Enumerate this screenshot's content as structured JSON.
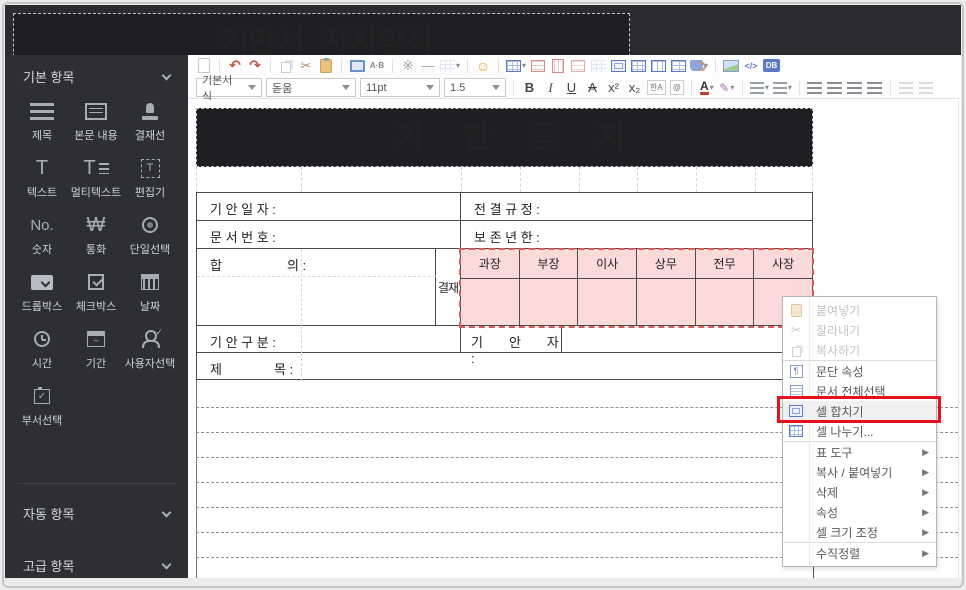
{
  "titlebar": {
    "title": "기안서_자사양식"
  },
  "sidebar": {
    "sections": [
      {
        "label": "기본 항목"
      },
      {
        "label": "자동 항목"
      },
      {
        "label": "고급 항목"
      }
    ],
    "items": [
      {
        "label": "제목"
      },
      {
        "label": "본문 내용"
      },
      {
        "label": "결재선"
      },
      {
        "label": "텍스트"
      },
      {
        "label": "멀티텍스트"
      },
      {
        "label": "편집기"
      },
      {
        "label": "숫자",
        "glyph": "No."
      },
      {
        "label": "통화",
        "glyph": "₩"
      },
      {
        "label": "단일선택"
      },
      {
        "label": "드롭박스"
      },
      {
        "label": "체크박스"
      },
      {
        "label": "날짜"
      },
      {
        "label": "시간"
      },
      {
        "label": "기간"
      },
      {
        "label": "사용자선택"
      },
      {
        "label": "부서선택"
      }
    ]
  },
  "toolbar": {
    "selects": [
      {
        "value": "기본서식"
      },
      {
        "value": "돋움"
      },
      {
        "value": "11pt"
      },
      {
        "value": "1.5"
      }
    ],
    "glyphs": {
      "undo": "↶",
      "redo": "↷",
      "cut": "✂",
      "special_char": "※",
      "hr": "—",
      "emoticon": "☺",
      "find_replace": "A·B",
      "code": "</>",
      "db": "DB",
      "hanja": "한A",
      "link": "@",
      "color_letter": "A",
      "pen": "✎"
    },
    "text_buttons": [
      "B",
      "I",
      "U",
      "A",
      "x²",
      "x₂"
    ]
  },
  "document": {
    "title": "기 안 용 지",
    "labels": {
      "draft_date": "기 안 일 자 :",
      "rule": "전 결 규 정 :",
      "doc_no": "문 서 번 호 :",
      "retention": "보 존 년 한 :",
      "agreement": "합　　　　　의 :",
      "approval": "결재",
      "draft_type": "기 안 구 분 :",
      "drafter": "기　　안　　자 :",
      "subject": "제　　　　목 :"
    },
    "approval_columns": [
      "과장",
      "부장",
      "이사",
      "상무",
      "전무",
      "사장"
    ]
  },
  "context_menu": {
    "submenu_arrow": "▶",
    "items": [
      {
        "label": "붙여넣기"
      },
      {
        "label": "잘라내기"
      },
      {
        "label": "복사하기"
      },
      {
        "label": "문단 속성"
      },
      {
        "label": "문서 전체선택"
      },
      {
        "label": "셀 합치기"
      },
      {
        "label": "셀 나누기..."
      },
      {
        "label": "표 도구"
      },
      {
        "label": "복사 / 붙여넣기"
      },
      {
        "label": "삭제"
      },
      {
        "label": "속성"
      },
      {
        "label": "셀 크기 조정"
      },
      {
        "label": "수직정렬"
      }
    ]
  },
  "colors": {
    "highlight_red": "#e8101c",
    "selection_pink": "#fbdada",
    "selection_border": "#dd5a5a",
    "sidebar_bg": "#2d2f33",
    "accent_blue": "#5b79c9"
  }
}
